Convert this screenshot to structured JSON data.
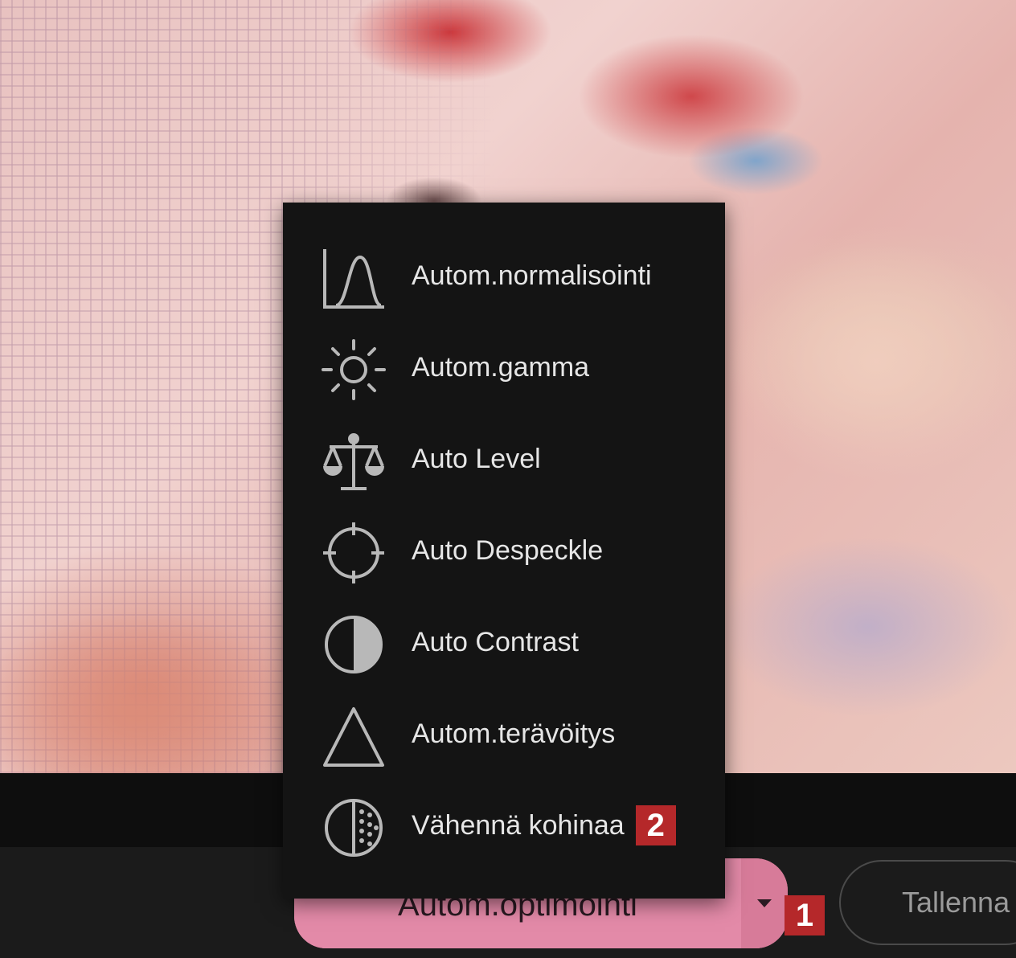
{
  "menu": {
    "items": [
      {
        "label": "Autom.normalisointi",
        "icon": "histogram-curve-icon"
      },
      {
        "label": "Autom.gamma",
        "icon": "sun-icon"
      },
      {
        "label": "Auto Level",
        "icon": "balance-scale-icon"
      },
      {
        "label": "Auto Despeckle",
        "icon": "crosshair-circle-icon"
      },
      {
        "label": "Auto Contrast",
        "icon": "half-circle-contrast-icon"
      },
      {
        "label": "Autom.terävöitys",
        "icon": "triangle-icon"
      },
      {
        "label": "Vähennä kohinaa",
        "icon": "noise-dots-circle-icon",
        "badge": "2"
      }
    ]
  },
  "toolbar": {
    "optimize_label": "Autom.optimointi",
    "save_label": "Tallenna",
    "optimize_badge": "1"
  },
  "colors": {
    "menu_bg": "#141414",
    "menu_text": "#e6e6e6",
    "button_accent": "#e38aa8",
    "badge": "#b5282a"
  }
}
